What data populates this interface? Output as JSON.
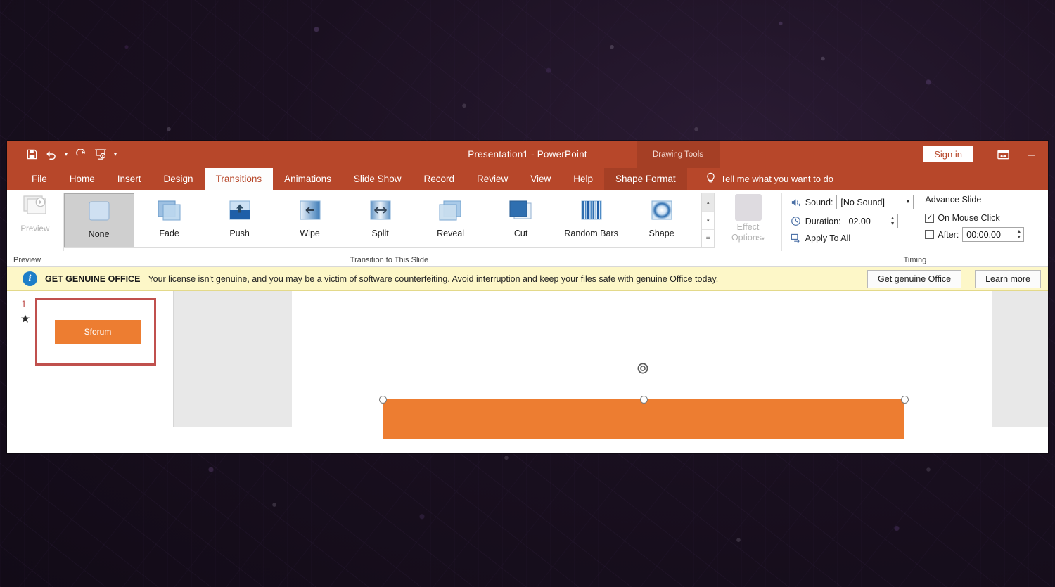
{
  "window": {
    "title": "Presentation1  -  PowerPoint",
    "contextual_tools_label": "Drawing Tools",
    "sign_in_label": "Sign in",
    "ribbon_display_icon": "ribbon-display-options-icon",
    "minimize_icon": "minimize-icon"
  },
  "quick_access": [
    {
      "name": "save-icon",
      "label": "Save"
    },
    {
      "name": "undo-icon",
      "label": "Undo"
    },
    {
      "name": "undo-dropdown-caret",
      "label": "▾"
    },
    {
      "name": "redo-icon",
      "label": "Redo"
    },
    {
      "name": "start-from-beginning-icon",
      "label": "Start From Beginning"
    },
    {
      "name": "customize-qat-caret",
      "label": "▾"
    }
  ],
  "tabs": [
    {
      "label": "File",
      "active": false
    },
    {
      "label": "Home",
      "active": false
    },
    {
      "label": "Insert",
      "active": false
    },
    {
      "label": "Design",
      "active": false
    },
    {
      "label": "Transitions",
      "active": true
    },
    {
      "label": "Animations",
      "active": false
    },
    {
      "label": "Slide Show",
      "active": false
    },
    {
      "label": "Record",
      "active": false
    },
    {
      "label": "Review",
      "active": false
    },
    {
      "label": "View",
      "active": false
    },
    {
      "label": "Help",
      "active": false
    },
    {
      "label": "Shape Format",
      "active": false,
      "contextual": true
    }
  ],
  "tell_me": {
    "label": "Tell me what you want to do",
    "icon": "lightbulb-icon"
  },
  "ribbon": {
    "preview_group": {
      "group_label": "Preview",
      "button_label": "Preview",
      "disabled": true
    },
    "transitions_group": {
      "group_label": "Transition to This Slide",
      "items": [
        {
          "label": "None",
          "selected": true,
          "thumb": "none-thumb"
        },
        {
          "label": "Fade",
          "selected": false,
          "thumb": "fade-thumb"
        },
        {
          "label": "Push",
          "selected": false,
          "thumb": "push-thumb"
        },
        {
          "label": "Wipe",
          "selected": false,
          "thumb": "wipe-thumb"
        },
        {
          "label": "Split",
          "selected": false,
          "thumb": "split-thumb"
        },
        {
          "label": "Reveal",
          "selected": false,
          "thumb": "reveal-thumb"
        },
        {
          "label": "Cut",
          "selected": false,
          "thumb": "cut-thumb"
        },
        {
          "label": "Random Bars",
          "selected": false,
          "thumb": "random-bars-thumb"
        },
        {
          "label": "Shape",
          "selected": false,
          "thumb": "shape-thumb"
        }
      ],
      "scroll_up": "▴",
      "scroll_down": "▾",
      "scroll_more": "☰"
    },
    "effect_options": {
      "label_line1": "Effect",
      "label_line2": "Options",
      "caret": "▾",
      "disabled": true
    },
    "timing_group": {
      "group_label": "Timing",
      "sound_label": "Sound:",
      "sound_value": "[No Sound]",
      "duration_label": "Duration:",
      "duration_value": "02.00",
      "apply_to_all_label": "Apply To All",
      "advance_slide_label": "Advance Slide",
      "on_mouse_click_label": "On Mouse Click",
      "on_mouse_click_checked": true,
      "after_label": "After:",
      "after_checked": false,
      "after_value": "00:00.00"
    }
  },
  "notification": {
    "icon": "info-icon",
    "headline": "GET GENUINE OFFICE",
    "message": "Your license isn't genuine, and you may be a victim of software counterfeiting. Avoid interruption and keep your files safe with genuine Office today.",
    "primary_button": "Get genuine Office",
    "secondary_button": "Learn more"
  },
  "slides_pane": {
    "slides": [
      {
        "number": "1",
        "has_animation": true,
        "shape_text": "Sforum",
        "selected": true
      }
    ]
  },
  "canvas": {
    "shape_text": "",
    "shape_fill": "#ED7D31",
    "rotation_handle": "rotate-handle-icon"
  },
  "colors": {
    "accent": "#B7472A",
    "contextual_tab": "#A53F25",
    "shape_orange": "#ED7D31",
    "notice_background": "#FDF7C8",
    "thumbnail_border": "#C0504D"
  }
}
